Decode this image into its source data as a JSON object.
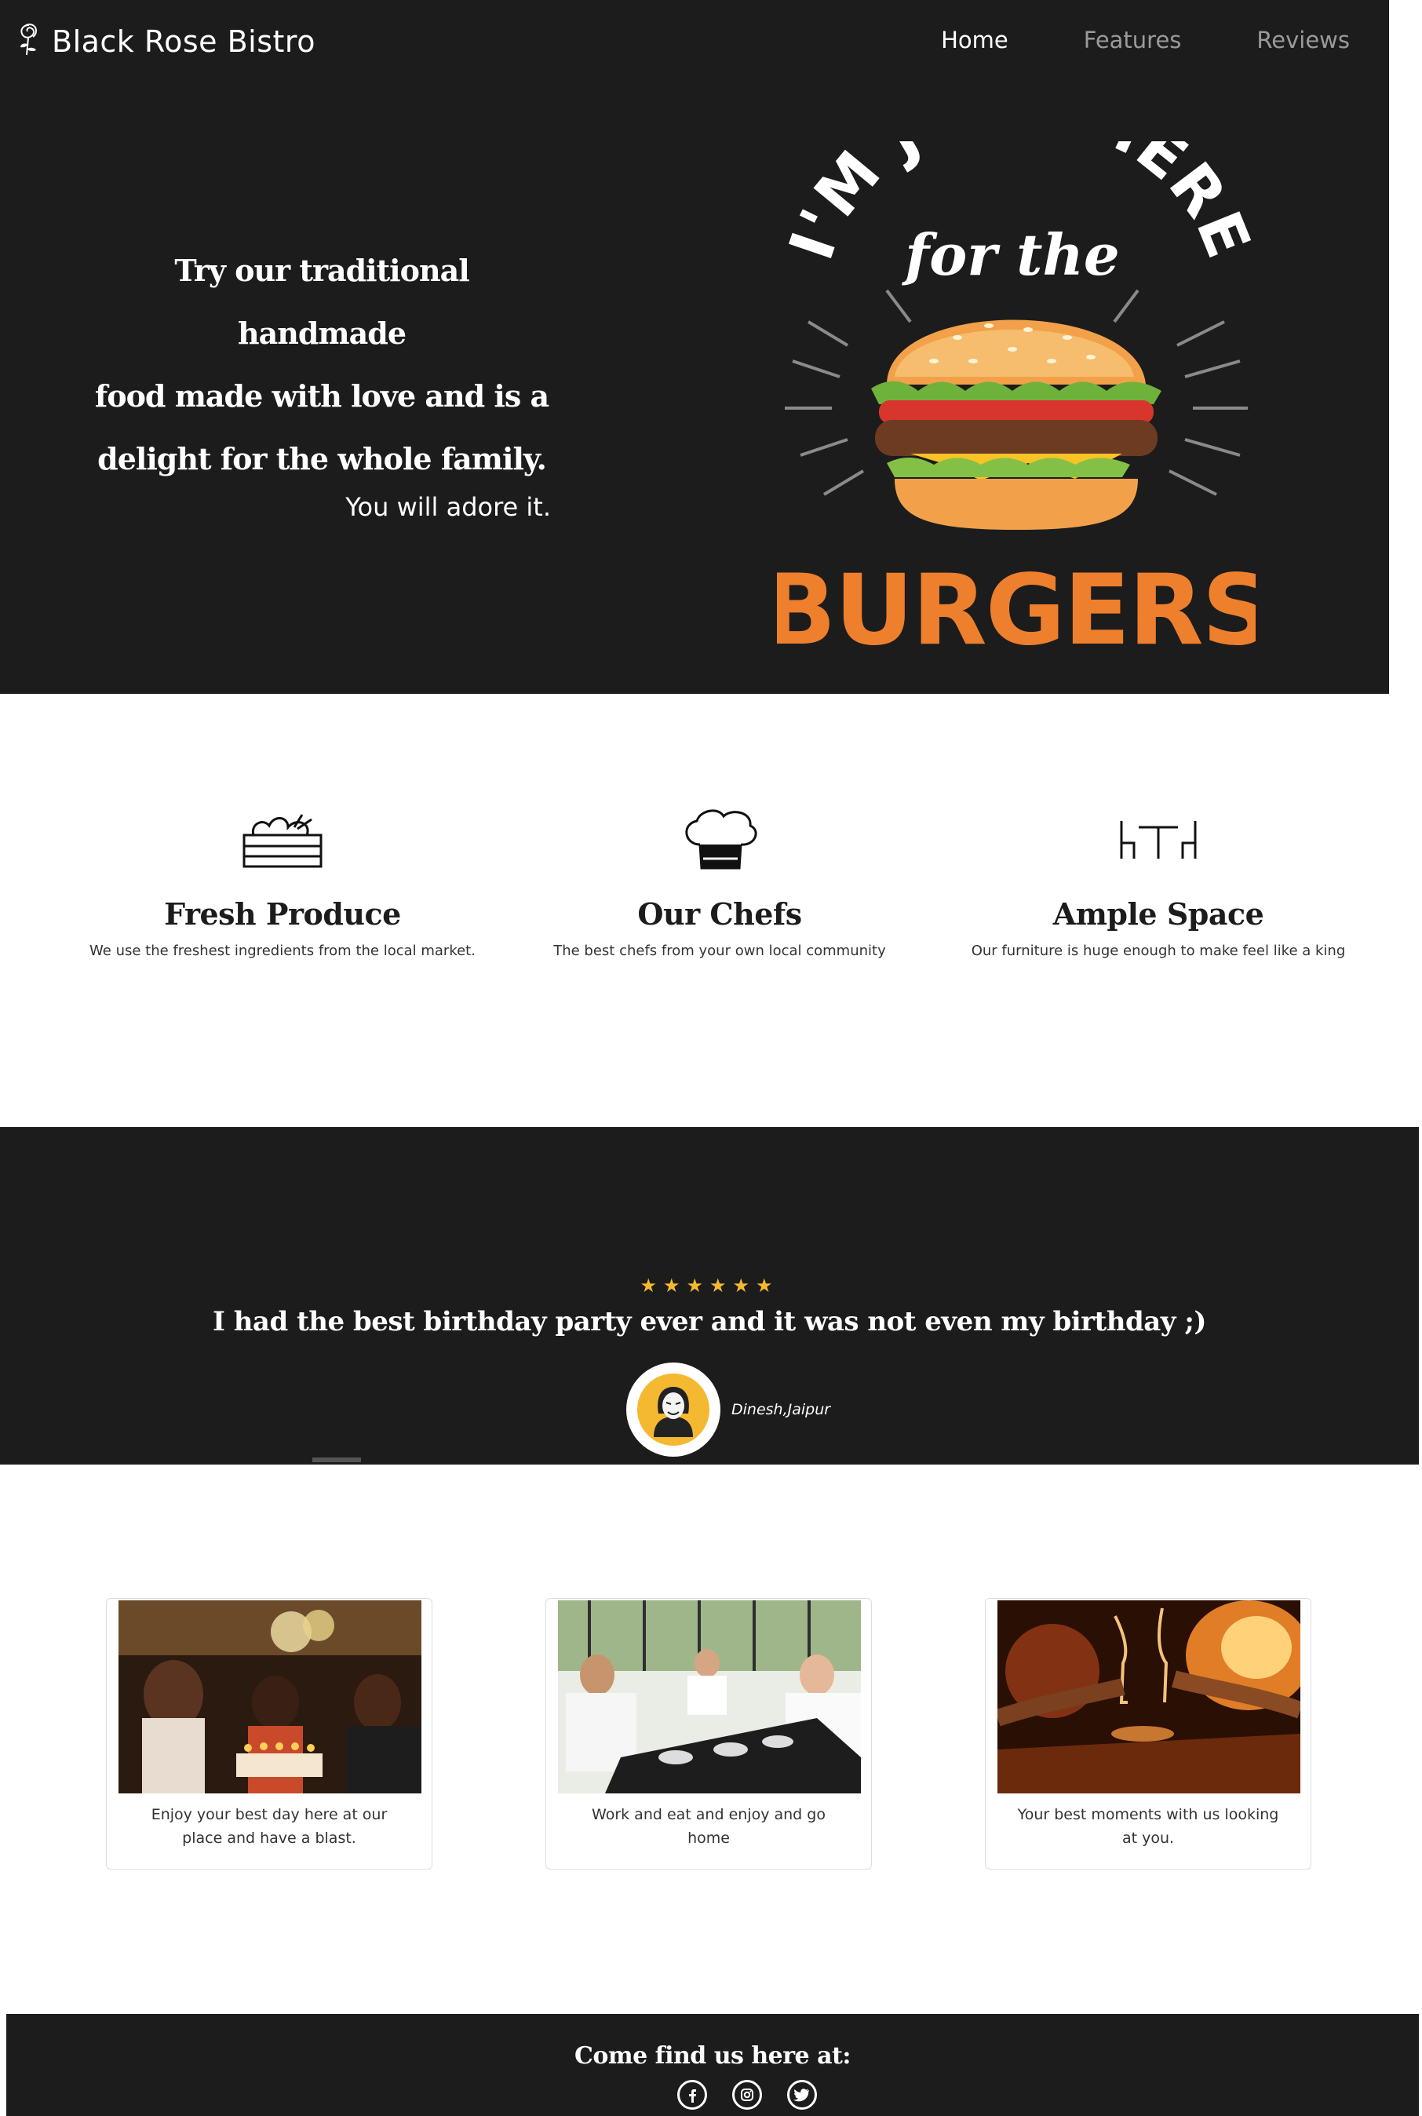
{
  "nav": {
    "brand": "Black Rose Bistro",
    "links": [
      "Home",
      "Features",
      "Reviews"
    ],
    "active": "Home"
  },
  "hero": {
    "headline_lines": [
      "Try our traditional handmade",
      "food made with love and is a",
      "delight for the whole family."
    ],
    "subline": "You will adore it.",
    "art_text_top": "I'M JUST HERE",
    "art_text_mid": "for the",
    "art_text_bottom": "BURGERS"
  },
  "features": [
    {
      "icon": "crate-icon",
      "title": "Fresh Produce",
      "desc": "We use the freshest ingredients from the local market."
    },
    {
      "icon": "chef-hat-icon",
      "title": "Our Chefs",
      "desc": "The best chefs from your own local community"
    },
    {
      "icon": "table-chairs-icon",
      "title": "Ample Space",
      "desc": "Our furniture is huge enough to make feel like a king"
    }
  ],
  "testimonial": {
    "stars": "★★★★★★",
    "quote": "I had the best birthday party ever and it was not even my birthday ;)",
    "reviewer": "Dinesh,Jaipur",
    "avatar_icon": "anonymous-mask-icon"
  },
  "gallery": [
    {
      "photo": "birthday-party-photo",
      "caption": "Enjoy your best day here at our place and have a blast."
    },
    {
      "photo": "group-dinner-photo",
      "caption": "Work and eat and enjoy and go home"
    },
    {
      "photo": "wine-fireplace-photo",
      "caption": "Your best moments with us looking at you."
    }
  ],
  "footer": {
    "title": "Come find us here at:",
    "socials": [
      "facebook-icon",
      "instagram-icon",
      "twitter-icon"
    ]
  },
  "colors": {
    "dark": "#1c1c1c",
    "star": "#f4b931",
    "burger_orange": "#ee7f2d"
  }
}
